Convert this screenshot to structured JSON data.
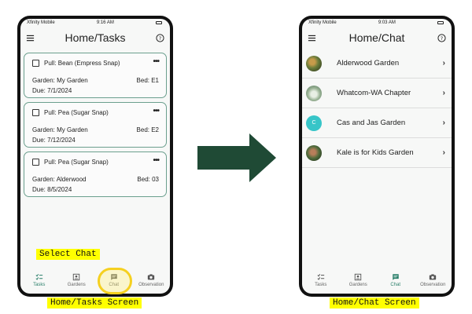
{
  "left_phone": {
    "status": {
      "carrier": "Xfinity Mobile",
      "time": "9:16 AM"
    },
    "title": "Home/Tasks",
    "tasks": [
      {
        "title": "Pull: Bean (Empress Snap)",
        "garden": "Garden: My Garden",
        "bed": "Bed: E1",
        "due": "Due: 7/1/2024"
      },
      {
        "title": "Pull: Pea (Sugar Snap)",
        "garden": "Garden: My Garden",
        "bed": "Bed: E2",
        "due": "Due: 7/12/2024"
      },
      {
        "title": "Pull: Pea (Sugar Snap)",
        "garden": "Garden: Alderwood",
        "bed": "Bed: 03",
        "due": "Due: 8/5/2024"
      }
    ],
    "nav": [
      "Tasks",
      "Gardens",
      "Chat",
      "Observation"
    ],
    "active_nav": "Tasks"
  },
  "right_phone": {
    "status": {
      "carrier": "Xfinity Mobile",
      "time": "9:03 AM"
    },
    "title": "Home/Chat",
    "chats": [
      {
        "name": "Alderwood Garden",
        "avatar": "photo"
      },
      {
        "name": "Whatcom-WA Chapter",
        "avatar": "photo"
      },
      {
        "name": "Cas and Jas Garden",
        "avatar": "C"
      },
      {
        "name": "Kale is for Kids Garden",
        "avatar": "photo"
      }
    ],
    "nav": [
      "Tasks",
      "Gardens",
      "Chat",
      "Observation"
    ],
    "active_nav": "Chat"
  },
  "annotations": {
    "select_chat": "Select Chat",
    "left_caption": "Home/Tasks Screen",
    "right_caption": "Home/Chat Screen"
  },
  "colors": {
    "accent": "#2a7f6a",
    "card_border": "#6b9f8e",
    "arrow": "#1f4a35",
    "highlight": "#ffff00"
  }
}
